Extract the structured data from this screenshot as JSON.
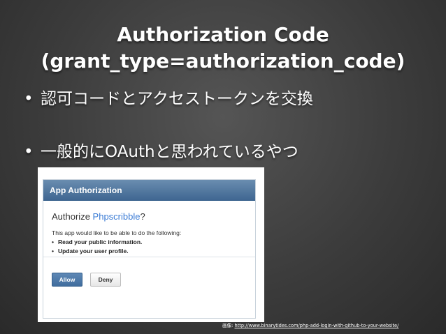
{
  "slide": {
    "title_line1": "Authorization Code",
    "title_line2": "(grant_type=authorization_code)",
    "bullets": [
      "認可コードとアクセストークンを交換",
      "一般的にOAuthと思われているやつ"
    ],
    "bullet_glyph": "•"
  },
  "screenshot": {
    "header": "App Authorization",
    "authorize_prefix": "Authorize ",
    "app_name": "Phpscribble",
    "authorize_suffix": "?",
    "description": "This app would like to be able to do the following:",
    "permissions": [
      "Read your public information.",
      "Update your user profile."
    ],
    "allow_label": "Allow",
    "deny_label": "Deny",
    "colors": {
      "header": "#4f7aa3",
      "app_name": "#3a7bd5",
      "allow": "#4a77a6"
    }
  },
  "credit": {
    "prefix": "画像: ",
    "url": "http://www.binarytides.com/php-add-login-with-github-to-your-website/"
  }
}
